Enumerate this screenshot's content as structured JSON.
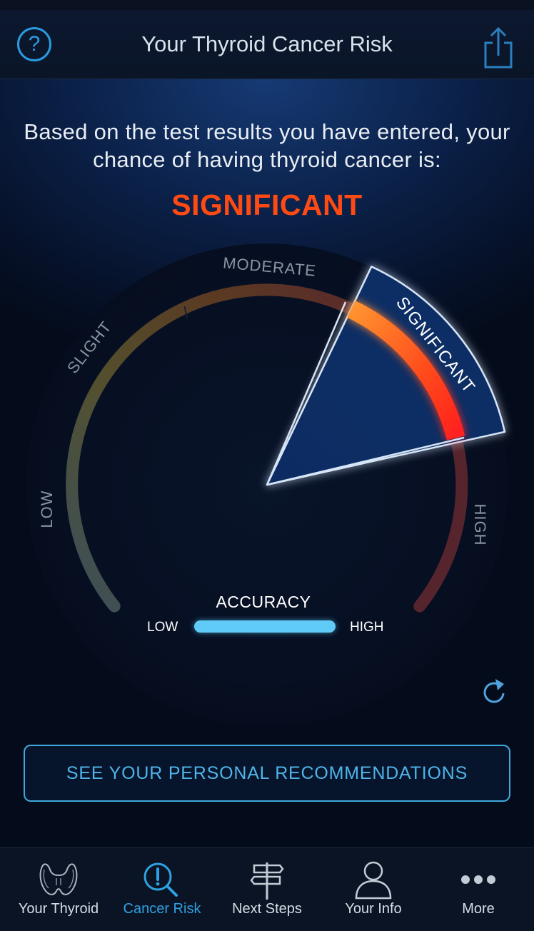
{
  "header": {
    "title": "Your Thyroid Cancer Risk",
    "help_icon": "question-circle-icon",
    "help_label": "?",
    "share_icon": "share-icon"
  },
  "result": {
    "intro": "Based on the test results you have entered, your chance of having thyroid cancer is:",
    "level": "SIGNIFICANT",
    "level_color": "#ff4a14"
  },
  "gauge": {
    "labels": {
      "low": "LOW",
      "slight": "SLIGHT",
      "moderate": "MODERATE",
      "significant": "SIGNIFICANT",
      "high": "HIGH"
    },
    "selected": "SIGNIFICANT"
  },
  "accuracy": {
    "title": "ACCURACY",
    "low_label": "LOW",
    "high_label": "HIGH",
    "level": 1.0
  },
  "refresh_icon": "refresh-icon",
  "recommendations_button": "SEE YOUR PERSONAL RECOMMENDATIONS",
  "tabs": [
    {
      "label": "Your Thyroid",
      "icon": "thyroid-icon",
      "active": false
    },
    {
      "label": "Cancer Risk",
      "icon": "risk-search-icon",
      "active": true
    },
    {
      "label": "Next Steps",
      "icon": "signpost-icon",
      "active": false
    },
    {
      "label": "Your Info",
      "icon": "person-icon",
      "active": false
    },
    {
      "label": "More",
      "icon": "more-dots-icon",
      "active": false
    }
  ],
  "colors": {
    "accent": "#2ea2e4",
    "risk": "#ff4a14",
    "accuracy_bar": "#60cbf7"
  }
}
